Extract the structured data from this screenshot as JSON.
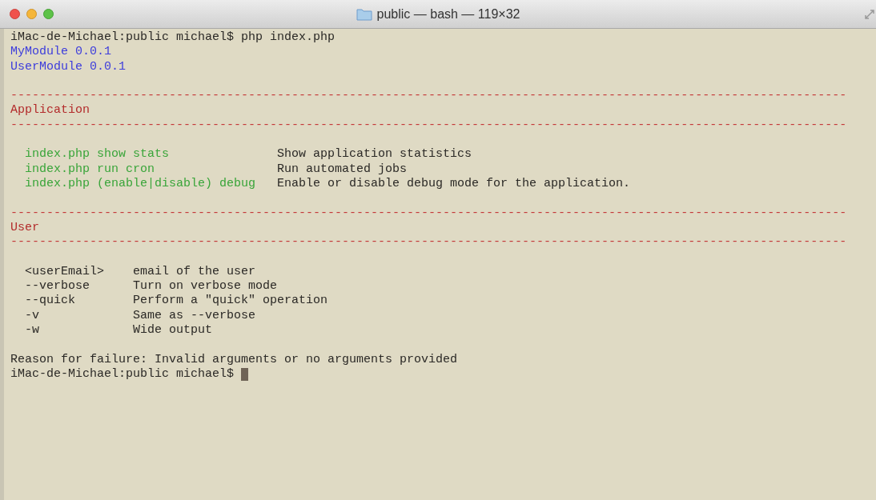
{
  "window": {
    "title": "public — bash — 119×32"
  },
  "terminal": {
    "lines": [
      {
        "kind": "text",
        "text": "iMac-de-Michael:public michael$ php index.php",
        "color": "#2b2926"
      },
      {
        "kind": "text",
        "text": "MyModule 0.0.1",
        "color": "#3d3ddc"
      },
      {
        "kind": "text",
        "text": "UserModule 0.0.1",
        "color": "#3d3ddc"
      },
      {
        "kind": "blank"
      },
      {
        "kind": "rule",
        "text": "--------------------------------------------------------------------------------------------------------------------",
        "color": "#c43a3a"
      },
      {
        "kind": "text",
        "text": "Application",
        "color": "#b32b2b"
      },
      {
        "kind": "rule",
        "text": "--------------------------------------------------------------------------------------------------------------------",
        "color": "#c43a3a"
      },
      {
        "kind": "blank"
      },
      {
        "kind": "command",
        "cells": [
          "index.php show stats",
          "Show application statistics"
        ],
        "color": "#3aa53a"
      },
      {
        "kind": "command",
        "cells": [
          "index.php run cron",
          "Run automated jobs"
        ],
        "color": "#3aa53a"
      },
      {
        "kind": "command",
        "cells": [
          "index.php (enable|disable) debug",
          "Enable or disable debug mode for the application."
        ],
        "color": "#3aa53a"
      },
      {
        "kind": "blank"
      },
      {
        "kind": "rule",
        "text": "--------------------------------------------------------------------------------------------------------------------",
        "color": "#c43a3a"
      },
      {
        "kind": "text",
        "text": "User",
        "color": "#b32b2b"
      },
      {
        "kind": "rule",
        "text": "--------------------------------------------------------------------------------------------------------------------",
        "color": "#c43a3a"
      },
      {
        "kind": "blank"
      },
      {
        "kind": "option",
        "cells": [
          "<userEmail>",
          "email of the user"
        ],
        "color": "#2b2926"
      },
      {
        "kind": "option",
        "cells": [
          "--verbose",
          "Turn on verbose mode"
        ],
        "color": "#2b2926"
      },
      {
        "kind": "option",
        "cells": [
          "--quick",
          "Perform a \"quick\" operation"
        ],
        "color": "#2b2926"
      },
      {
        "kind": "option",
        "cells": [
          "-v",
          "Same as --verbose"
        ],
        "color": "#2b2926"
      },
      {
        "kind": "option",
        "cells": [
          "-w",
          "Wide output"
        ],
        "color": "#2b2926"
      },
      {
        "kind": "blank"
      },
      {
        "kind": "text",
        "text": "Reason for failure: Invalid arguments or no arguments provided",
        "color": "#2b2926"
      },
      {
        "kind": "prompt",
        "text": "iMac-de-Michael:public michael$",
        "color": "#2b2926",
        "cursor": true
      }
    ]
  }
}
